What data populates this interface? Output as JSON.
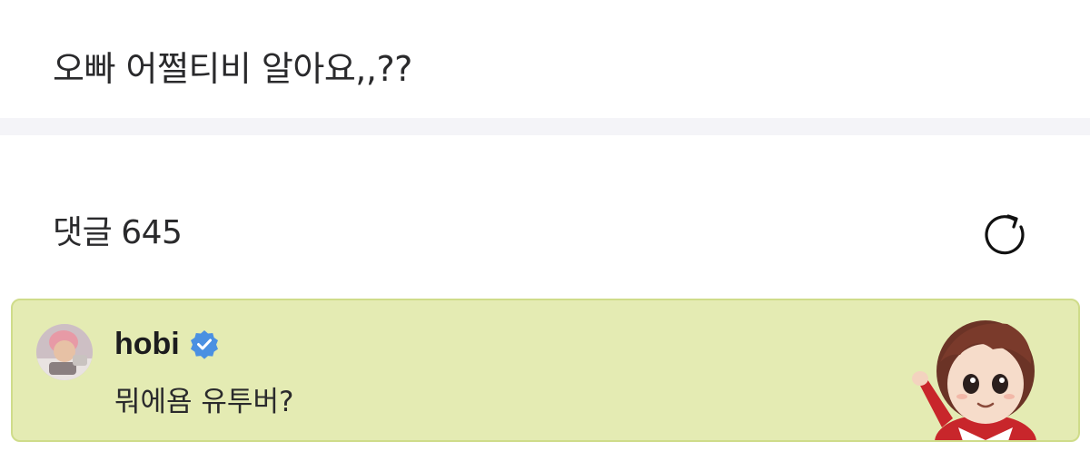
{
  "post": {
    "text": "오빠 어쩔티비 알아요,,??"
  },
  "comments_header": {
    "label": "댓글",
    "count": "645",
    "refresh_icon": "refresh-icon"
  },
  "comment": {
    "author": "hobi",
    "verified_icon": "verified-badge-icon",
    "text": "뭐에욤 유투버?",
    "highlight_color": "#e4ebb3",
    "badge_color": "#4a90e2"
  }
}
